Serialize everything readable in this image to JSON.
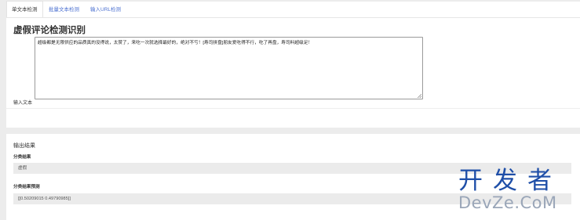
{
  "tabs": [
    {
      "label": "单文本检测",
      "active": true
    },
    {
      "label": "批量文本检测",
      "active": false
    },
    {
      "label": "输入URL检测",
      "active": false
    }
  ],
  "form": {
    "title": "虚假评论检测识别",
    "input_label": "输入文本",
    "input_value": "超级都是无限供应的品质真的没得说，太赞了，来吃一次就选择最好的，绝对不亏！[寿司拼盘]朋友爱吃得不行，吃了再盘，寿司料超级足！"
  },
  "output": {
    "heading": "输出结果",
    "class_label": "分类结果",
    "class_value": "虚假",
    "pred_label": "分类结果预测",
    "pred_value": "[[0.50209015 0.49790985]]"
  },
  "watermark": {
    "line1": "开发者",
    "line2": "DevZe.CoM"
  },
  "colors": {
    "tab_link": "#4a6fd0",
    "background": "#ececec",
    "field_bg": "#ebebeb",
    "watermark_blue": "#1f4fa8"
  }
}
